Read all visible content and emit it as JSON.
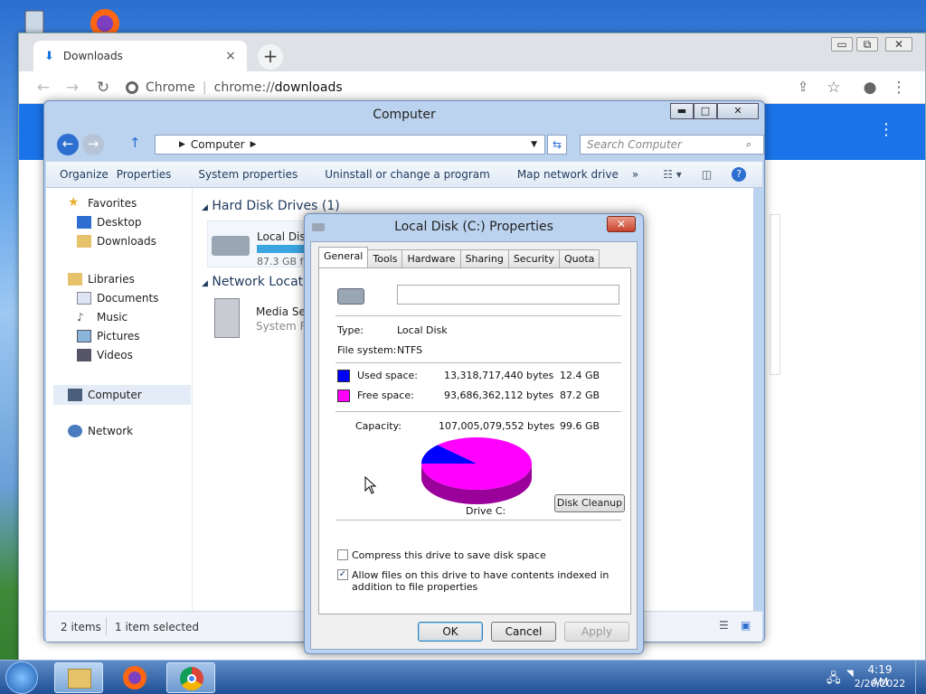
{
  "chrome": {
    "tab_title": "Downloads",
    "tab_close": "×",
    "new_tab": "+",
    "url_scheme": "chrome://",
    "url_host": "downloads",
    "url_label": "Chrome",
    "min": "▭",
    "max": "⧉",
    "close": "✕"
  },
  "explorer": {
    "title": "Computer",
    "breadcrumb": "Computer",
    "search_placeholder": "Search Computer",
    "commands": [
      "Organize",
      "Properties",
      "System properties",
      "Uninstall or change a program",
      "Map network drive",
      "»"
    ],
    "nav_items": {
      "favorites": "Favorites",
      "desktop": "Desktop",
      "downloads": "Downloads",
      "libraries": "Libraries",
      "documents": "Documents",
      "music": "Music",
      "pictures": "Pictures",
      "videos": "Videos",
      "computer": "Computer",
      "network": "Network"
    },
    "sections": {
      "hard_disk_drives": "Hard Disk Drives (1)",
      "network_locations": "Network Locati"
    },
    "drive": {
      "label": "Local Disk",
      "free_text": "87.3 GB fr"
    },
    "media": {
      "label": "Media Se",
      "sublabel": "System F"
    },
    "status_items": "2 items",
    "status_selected": "1 item selected"
  },
  "dialog": {
    "title": "Local Disk (C:) Properties",
    "tabs": [
      "General",
      "Tools",
      "Hardware",
      "Sharing",
      "Security",
      "Quota"
    ],
    "active_tab": "General",
    "name_value": "",
    "type_label": "Type:",
    "type_value": "Local Disk",
    "fs_label": "File system:",
    "fs_value": "NTFS",
    "used_label": "Used space:",
    "used_bytes": "13,318,717,440 bytes",
    "used_gb": "12.4 GB",
    "free_label": "Free space:",
    "free_bytes": "93,686,362,112 bytes",
    "free_gb": "87.2 GB",
    "cap_label": "Capacity:",
    "cap_bytes": "107,005,079,552 bytes",
    "cap_gb": "99.6 GB",
    "used_fraction": 0.1245,
    "drive_label": "Drive C:",
    "disk_cleanup": "Disk Cleanup",
    "compress_label": "Compress this drive to save disk space",
    "compress_checked": false,
    "index_label": "Allow files on this drive to have contents indexed in addition to file properties",
    "index_checked": true,
    "ok": "OK",
    "cancel": "Cancel",
    "apply": "Apply",
    "colors": {
      "used": "#0000ff",
      "free": "#ff00ff"
    }
  },
  "taskbar": {
    "time": "4:19 AM",
    "date": "2/20/2022"
  }
}
